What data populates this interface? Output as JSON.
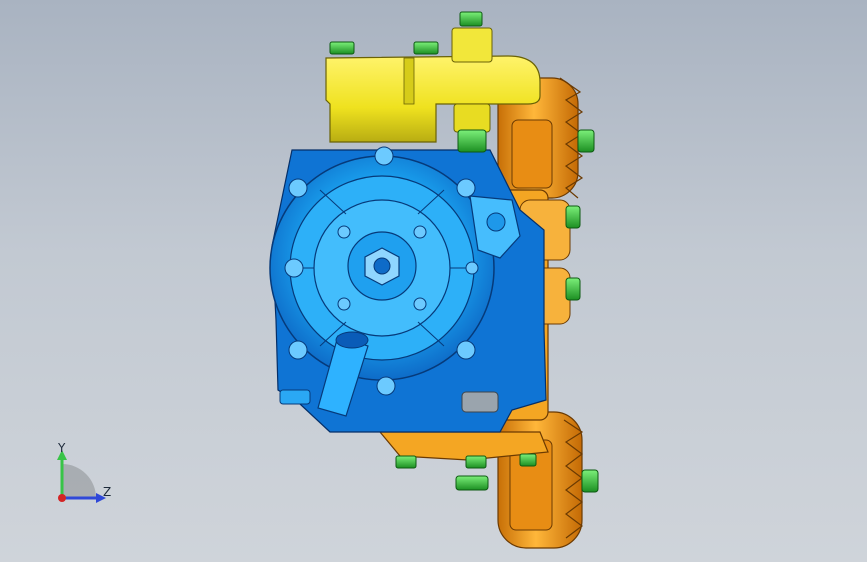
{
  "viewport": {
    "background_top": "#a9b3c1",
    "background_bottom": "#cfd4da"
  },
  "model": {
    "colors": {
      "housing_blue": "#1aa3f0",
      "housing_dark_blue": "#0d5fbf",
      "bracket_yellow": "#f3ea2c",
      "pulley_orange": "#f0a21c",
      "bolt_green": "#39c23a",
      "steel": "#9aa4ad"
    },
    "icons": [
      "water-pump-assembly",
      "pulley",
      "bolt"
    ]
  },
  "triad": {
    "y_label": "Y",
    "z_label": "Z",
    "y_color": "#38c447",
    "z_color": "#2f48d8",
    "origin_color": "#d32424"
  }
}
